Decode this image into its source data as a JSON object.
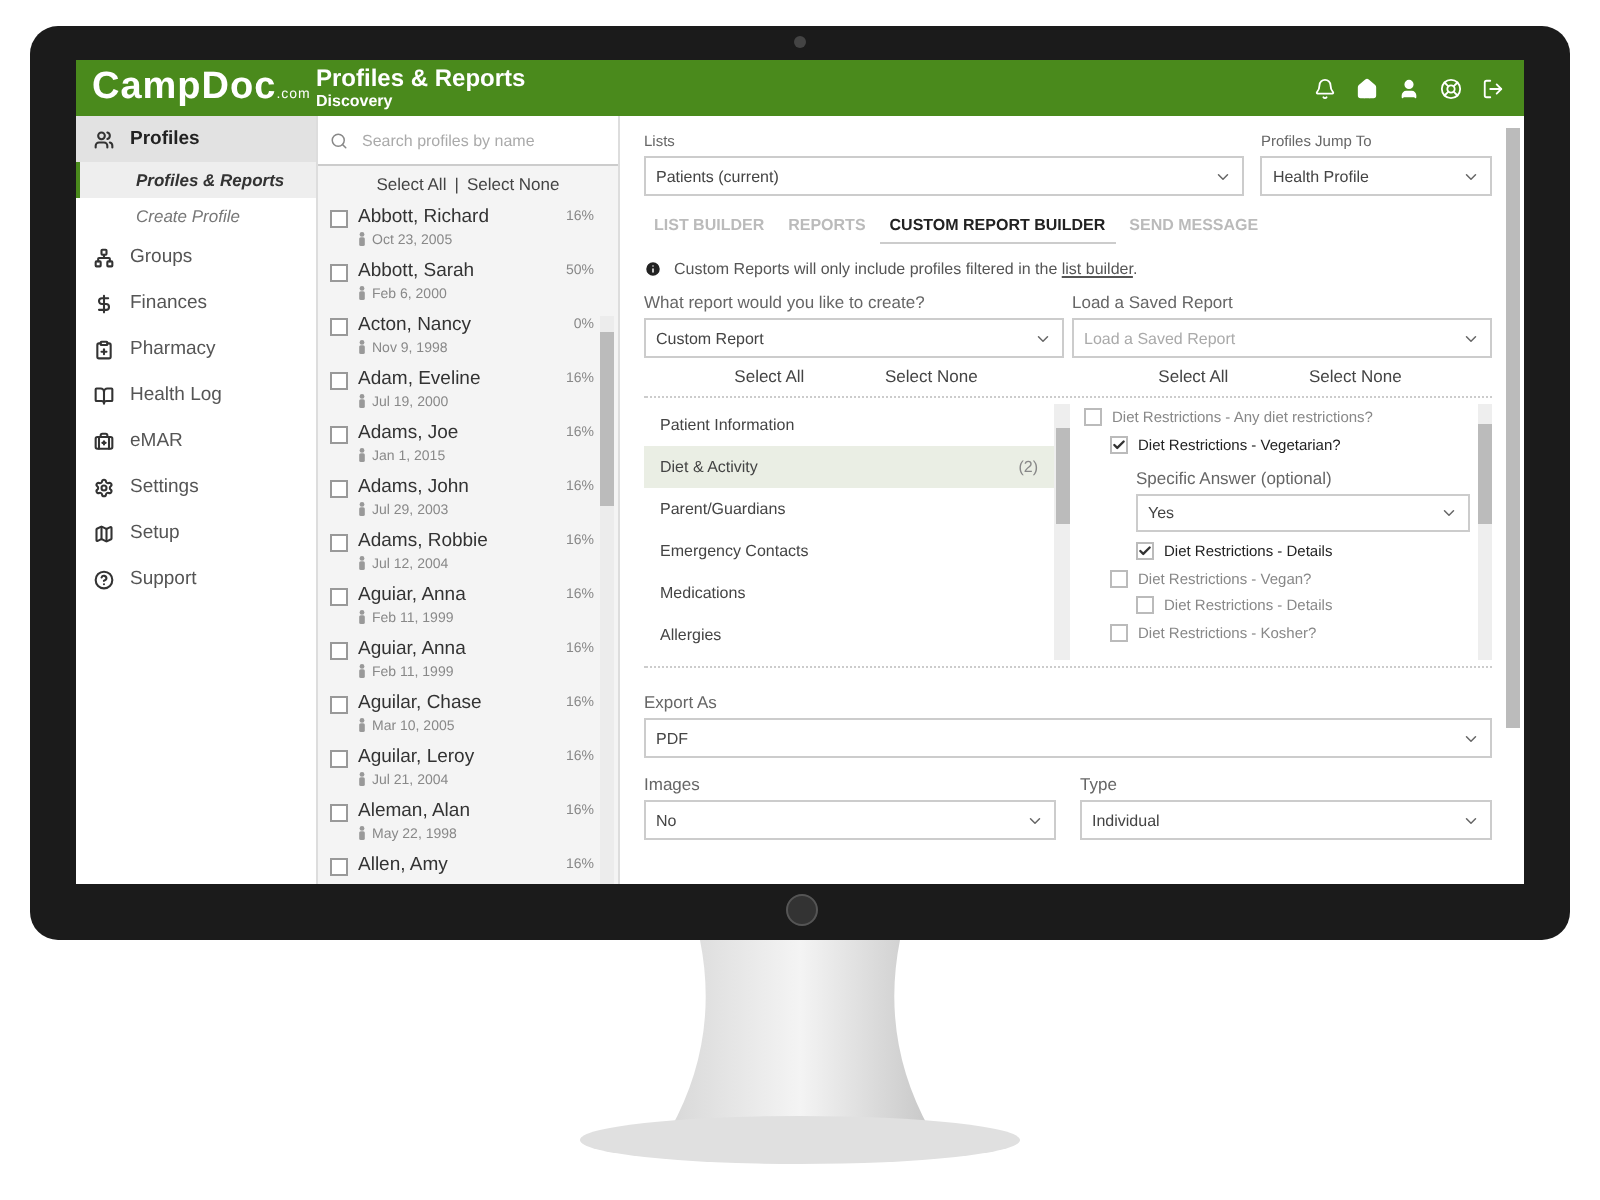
{
  "header": {
    "logo": "CampDoc",
    "logo_suffix": ".com",
    "title": "Profiles & Reports",
    "subtitle": "Discovery"
  },
  "sidebar": {
    "items": [
      {
        "label": "Profiles",
        "selected": true,
        "children": [
          {
            "label": "Profiles & Reports",
            "selected": true
          },
          {
            "label": "Create Profile",
            "selected": false
          }
        ]
      },
      {
        "label": "Groups",
        "selected": false
      },
      {
        "label": "Finances",
        "selected": false
      },
      {
        "label": "Pharmacy",
        "selected": false
      },
      {
        "label": "Health Log",
        "selected": false
      },
      {
        "label": "eMAR",
        "selected": false
      },
      {
        "label": "Settings",
        "selected": false
      },
      {
        "label": "Setup",
        "selected": false
      },
      {
        "label": "Support",
        "selected": false
      }
    ]
  },
  "profiles": {
    "search_placeholder": "Search profiles by name",
    "select_all": "Select All",
    "separator": "|",
    "select_none": "Select None",
    "rows": [
      {
        "name": "Abbott, Richard",
        "date": "Oct 23, 2005",
        "percent": "16%",
        "checked": false
      },
      {
        "name": "Abbott, Sarah",
        "date": "Feb 6, 2000",
        "percent": "50%",
        "checked": false
      },
      {
        "name": "Acton, Nancy",
        "date": "Nov 9, 1998",
        "percent": "0%",
        "checked": false
      },
      {
        "name": "Adam, Eveline",
        "date": "Jul 19, 2000",
        "percent": "16%",
        "checked": false
      },
      {
        "name": "Adams, Joe",
        "date": "Jan 1, 2015",
        "percent": "16%",
        "checked": false
      },
      {
        "name": "Adams, John",
        "date": "Jul 29, 2003",
        "percent": "16%",
        "checked": false
      },
      {
        "name": "Adams, Robbie",
        "date": "Jul 12, 2004",
        "percent": "16%",
        "checked": false
      },
      {
        "name": "Aguiar, Anna",
        "date": "Feb 11, 1999",
        "percent": "16%",
        "checked": false
      },
      {
        "name": "Aguiar, Anna",
        "date": "Feb 11, 1999",
        "percent": "16%",
        "checked": false
      },
      {
        "name": "Aguilar, Chase",
        "date": "Mar 10, 2005",
        "percent": "16%",
        "checked": false
      },
      {
        "name": "Aguilar, Leroy",
        "date": "Jul 21, 2004",
        "percent": "16%",
        "checked": false
      },
      {
        "name": "Aleman, Alan",
        "date": "May 22, 1998",
        "percent": "16%",
        "checked": false
      },
      {
        "name": "Allen, Amy",
        "percent": "16%",
        "checked": false
      }
    ]
  },
  "main": {
    "lists": {
      "label": "Lists",
      "value": "Patients (current)"
    },
    "jump": {
      "label": "Profiles Jump To",
      "value": "Health Profile"
    },
    "tabs": [
      {
        "label": "LIST BUILDER",
        "selected": false
      },
      {
        "label": "REPORTS",
        "selected": false
      },
      {
        "label": "CUSTOM REPORT BUILDER",
        "selected": true
      },
      {
        "label": "SEND MESSAGE",
        "selected": false
      }
    ],
    "info": {
      "text": "Custom Reports will only include profiles filtered in the ",
      "link": "list builder",
      "end": "."
    },
    "report": {
      "label": "What report would you like to create?",
      "value": "Custom Report"
    },
    "saved": {
      "label": "Load a Saved Report",
      "placeholder": "Load a Saved Report"
    },
    "left_select_all": "Select All",
    "left_select_none": "Select None",
    "right_select_all": "Select All",
    "right_select_none": "Select None",
    "categories": [
      {
        "label": "Patient Information",
        "selected": false
      },
      {
        "label": "Diet & Activity",
        "count": "(2)",
        "selected": true
      },
      {
        "label": "Parent/Guardians",
        "selected": false
      },
      {
        "label": "Emergency Contacts",
        "selected": false
      },
      {
        "label": "Medications",
        "selected": false
      },
      {
        "label": "Allergies",
        "selected": false
      }
    ],
    "fields": [
      {
        "label": "Diet Restrictions - Any diet restrictions?",
        "checked": false,
        "children": [
          {
            "label": "Diet Restrictions - Vegetarian?",
            "checked": true,
            "answer": {
              "label": "Specific Answer (optional)",
              "value": "Yes"
            },
            "children": [
              {
                "label": "Diet Restrictions - Details",
                "checked": true
              }
            ]
          },
          {
            "label": "Diet Restrictions - Vegan?",
            "checked": false,
            "children": [
              {
                "label": "Diet Restrictions - Details",
                "checked": false
              }
            ]
          },
          {
            "label": "Diet Restrictions - Kosher?",
            "checked": false
          }
        ]
      }
    ],
    "export": {
      "label": "Export As",
      "value": "PDF"
    },
    "images": {
      "label": "Images",
      "value": "No"
    },
    "type": {
      "label": "Type",
      "value": "Individual"
    }
  }
}
